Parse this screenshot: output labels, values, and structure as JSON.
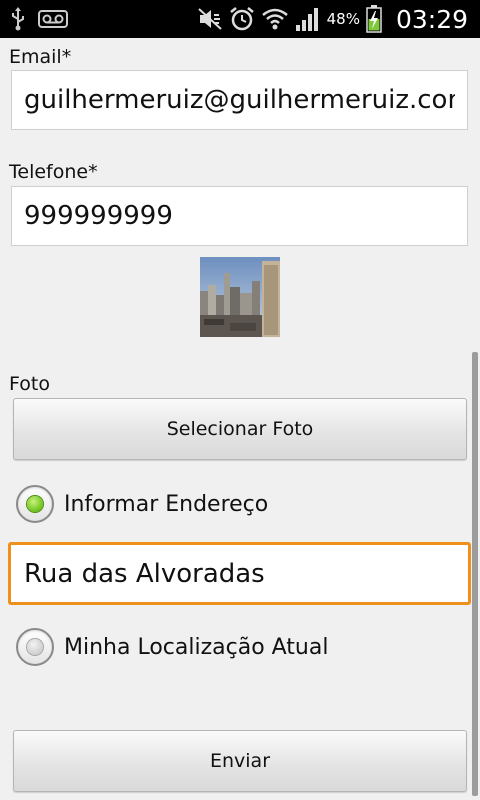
{
  "status_bar": {
    "icons_left": [
      "usb-icon",
      "voicemail-icon"
    ],
    "icons_right": [
      "mute-icon",
      "alarm-icon",
      "wifi-icon",
      "signal-icon",
      "battery-charging-icon"
    ],
    "battery_percent": "48%",
    "clock": "03:29"
  },
  "form": {
    "email": {
      "label": "Email*",
      "value": "guilhermeruiz@guilhermeruiz.com.br"
    },
    "phone": {
      "label": "Telefone*",
      "value": "999999999"
    },
    "photo": {
      "label": "Foto",
      "button_label": "Selecionar Foto"
    },
    "address_option": {
      "label": "Informar Endereço",
      "selected": true
    },
    "address": {
      "value": "Rua das Alvoradas"
    },
    "location_option": {
      "label": "Minha Localização Atual",
      "selected": false
    },
    "submit_label": "Enviar"
  },
  "colors": {
    "focus_border": "#ef8f1c",
    "radio_selected": "#6cc21b",
    "status_bar_bg": "#000000"
  }
}
